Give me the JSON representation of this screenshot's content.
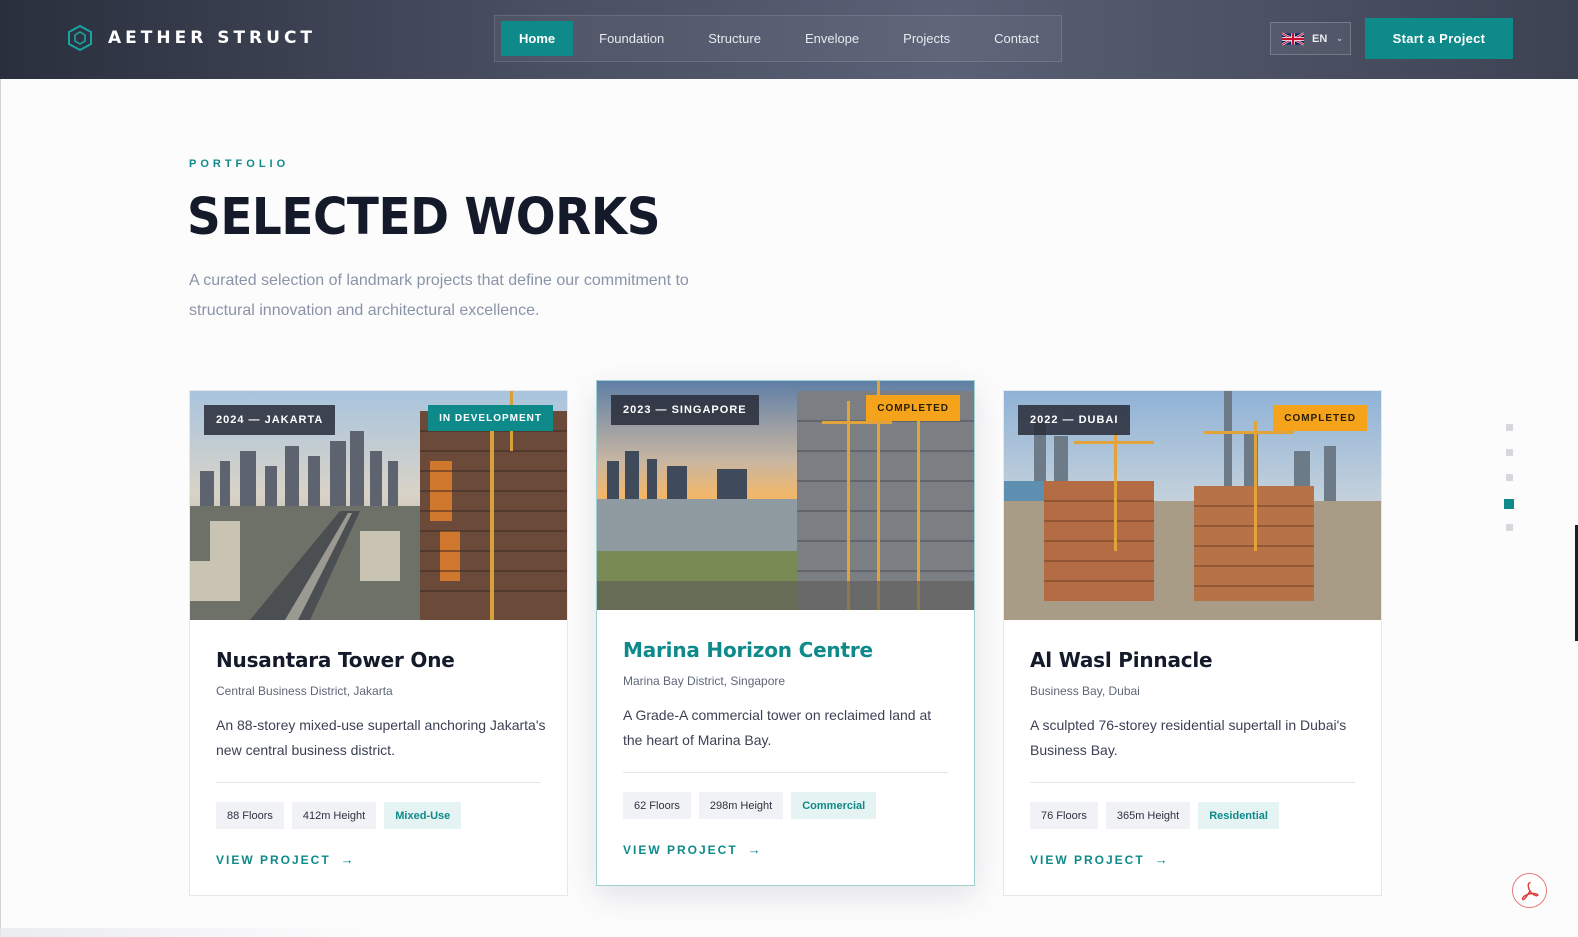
{
  "brand": {
    "name": "AETHER STRUCT",
    "icon": "hexagon-logo-icon",
    "accent": "#0e8a8a"
  },
  "nav": {
    "items": [
      {
        "label": "Home",
        "active": true
      },
      {
        "label": "Foundation",
        "active": false
      },
      {
        "label": "Structure",
        "active": false
      },
      {
        "label": "Envelope",
        "active": false
      },
      {
        "label": "Projects",
        "active": false
      },
      {
        "label": "Contact",
        "active": false
      }
    ]
  },
  "language": {
    "code": "EN",
    "flag_icon": "uk-flag-icon"
  },
  "cta": {
    "label": "Start a Project"
  },
  "section": {
    "eyebrow": "PORTFOLIO",
    "title": "SELECTED WORKS",
    "intro": "A curated selection of landmark projects that define our commitment to structural innovation and architectural excellence."
  },
  "projects": [
    {
      "badge": "2024 — JAKARTA",
      "status": "IN DEVELOPMENT",
      "title": "Nusantara Tower One",
      "location": "Central Business District, Jakarta",
      "description": "An 88-storey mixed-use supertall anchoring Jakarta's new central business district.",
      "floors": "88 Floors",
      "height": "412m Height",
      "type": "Mixed-Use",
      "link": "VIEW PROJECT"
    },
    {
      "badge": "2023 — SINGAPORE",
      "status": "COMPLETED",
      "title": "Marina Horizon Centre",
      "location": "Marina Bay District, Singapore",
      "description": "A Grade-A commercial tower on reclaimed land at the heart of Marina Bay.",
      "floors": "62 Floors",
      "height": "298m Height",
      "type": "Commercial",
      "link": "VIEW PROJECT"
    },
    {
      "badge": "2022 — DUBAI",
      "status": "COMPLETED",
      "title": "Al Wasl Pinnacle",
      "location": "Business Bay, Dubai",
      "description": "A sculpted 76-storey residential supertall in Dubai's Business Bay.",
      "floors": "76 Floors",
      "height": "365m Height",
      "type": "Residential",
      "link": "VIEW PROJECT"
    }
  ],
  "arrow_glyph": "→",
  "chevron_glyph": "⌄",
  "pagination": {
    "count": 5,
    "active_index": 3
  },
  "fab": {
    "icon": "pdf-icon"
  }
}
